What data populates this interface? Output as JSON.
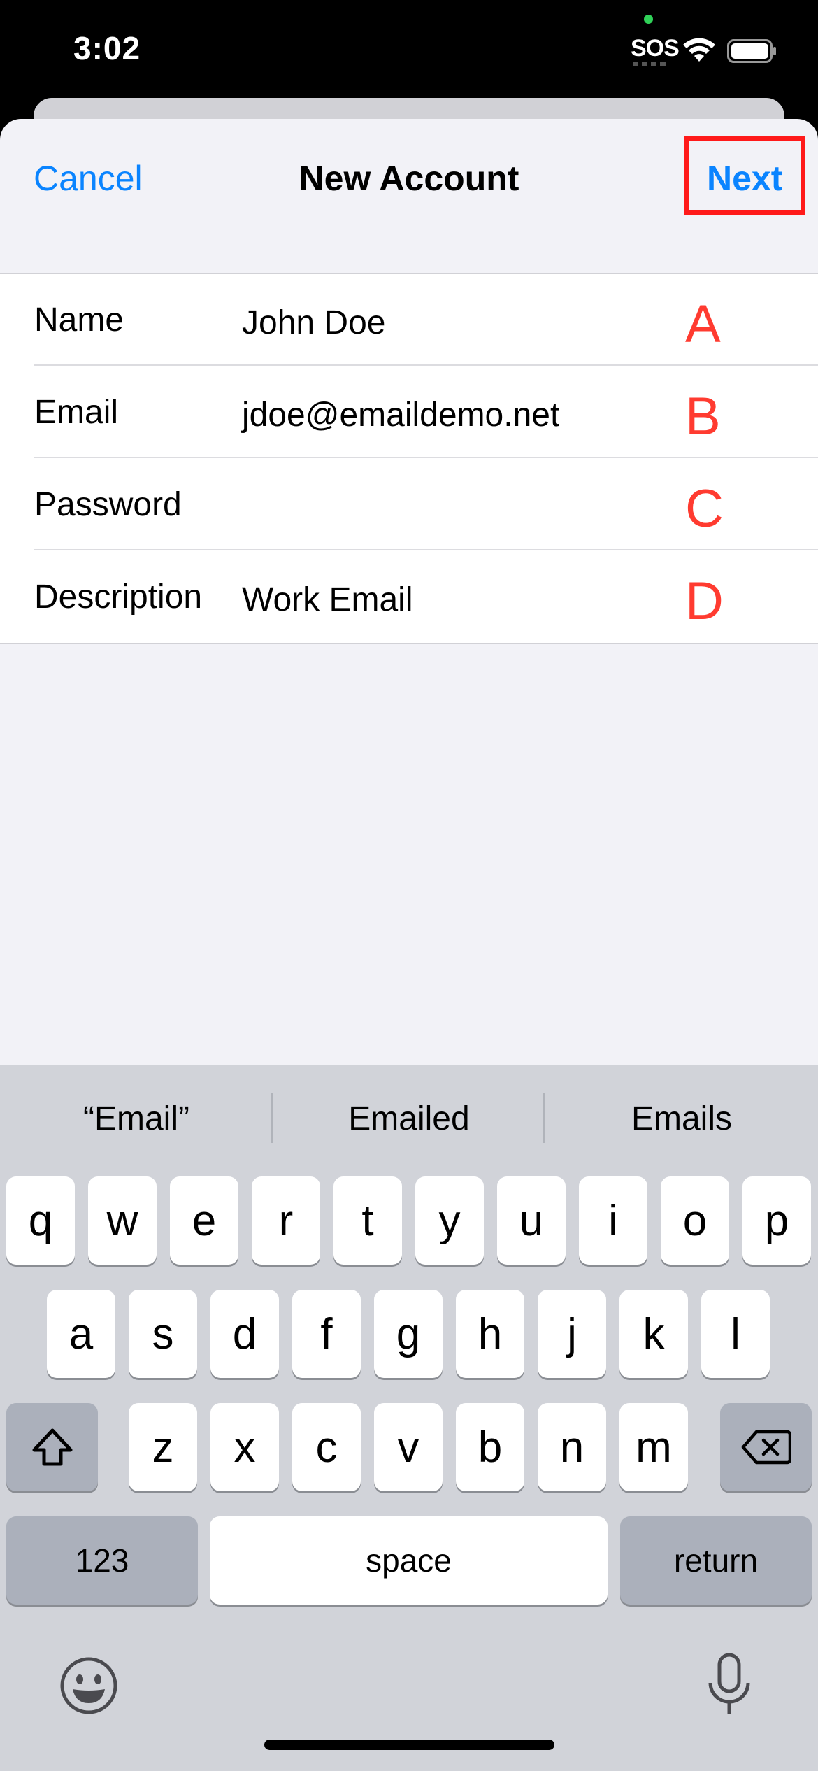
{
  "status_bar": {
    "time": "3:02",
    "carrier": "SOS",
    "wifi_icon": "wifi-icon",
    "battery_icon": "battery-icon"
  },
  "nav": {
    "cancel": "Cancel",
    "title": "New Account",
    "next": "Next",
    "highlight_color": "#ff1a1a"
  },
  "form": {
    "rows": [
      {
        "label": "Name",
        "value": "John Doe",
        "tag": "A"
      },
      {
        "label": "Email",
        "value": "jdoe@emaildemo.net",
        "tag": "B"
      },
      {
        "label": "Password",
        "value": "",
        "tag": "C"
      },
      {
        "label": "Description",
        "value": "Work Email",
        "tag": "D"
      }
    ]
  },
  "keyboard": {
    "suggestions": [
      "“Email”",
      "Emailed",
      "Emails"
    ],
    "row1": [
      "q",
      "w",
      "e",
      "r",
      "t",
      "y",
      "u",
      "i",
      "o",
      "p"
    ],
    "row2": [
      "a",
      "s",
      "d",
      "f",
      "g",
      "h",
      "j",
      "k",
      "l"
    ],
    "row3": [
      "z",
      "x",
      "c",
      "v",
      "b",
      "n",
      "m"
    ],
    "numbers_key": "123",
    "space_key": "space",
    "return_key": "return",
    "shift_icon": "shift-icon",
    "delete_icon": "delete-icon",
    "emoji_icon": "emoji-icon",
    "mic_icon": "microphone-icon"
  },
  "colors": {
    "accent": "#0a84ff",
    "tag_red": "#ff3b30"
  }
}
